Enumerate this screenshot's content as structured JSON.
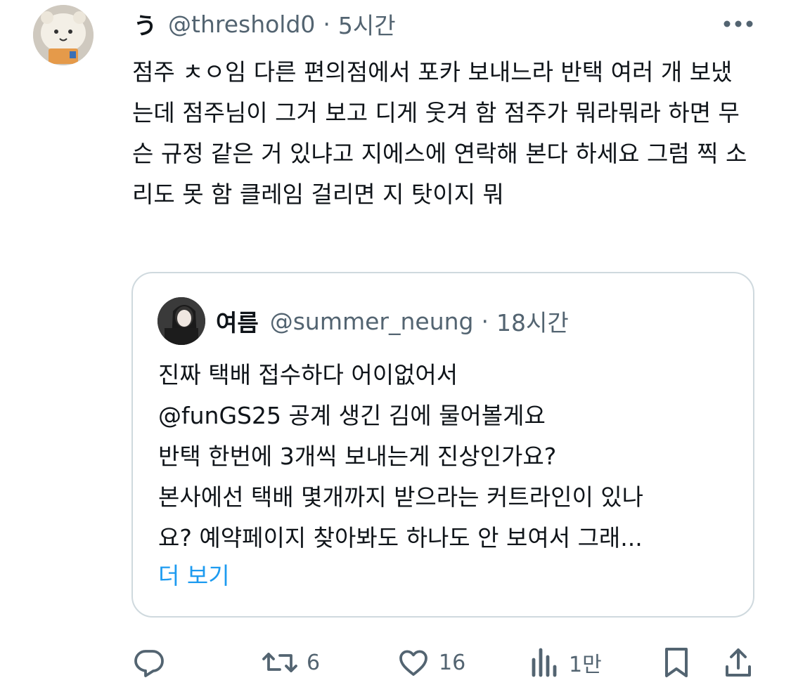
{
  "tweet": {
    "display_name": "う",
    "handle": "@threshold0",
    "separator": "·",
    "time": "5시간",
    "text": "점주 ㅊㅇ임 다른 편의점에서 포카 보내느라 반택 여러 개 보냈는데 점주님이 그거 보고 디게 웃겨 함 점주가 뭐라뭐라 하면 무슨 규정 같은 거 있냐고 지에스에 연락해 본다 하세요 그럼 찍 소리도 못 함 클레임 걸리면 지 탓이지 뭐"
  },
  "quote": {
    "display_name": "여름",
    "handle": "@summer_neung",
    "separator": "·",
    "time": "18시간",
    "lines": [
      "진짜 택배 접수하다 어이없어서",
      "@funGS25 공계 생긴 김에 물어볼게요",
      "반택 한번에 3개씩 보내는게 진상인가요?",
      "본사에선 택배 몇개까지 받으라는 커트라인이 있나",
      "요? 예약페이지 찾아봐도 하나도 안 보여서 그래..."
    ],
    "show_more": "더 보기"
  },
  "actions": {
    "reply_count": "",
    "retweet_count": "6",
    "like_count": "16",
    "views_count": "1만"
  },
  "icons": {
    "reply": "reply-icon",
    "retweet": "retweet-icon",
    "like": "heart-icon",
    "views": "views-icon",
    "bookmark": "bookmark-icon",
    "share": "share-icon",
    "more": "more-icon"
  },
  "colors": {
    "text": "#0f1419",
    "secondary": "#536471",
    "link": "#1d9bf0",
    "border": "#cfd9de"
  }
}
